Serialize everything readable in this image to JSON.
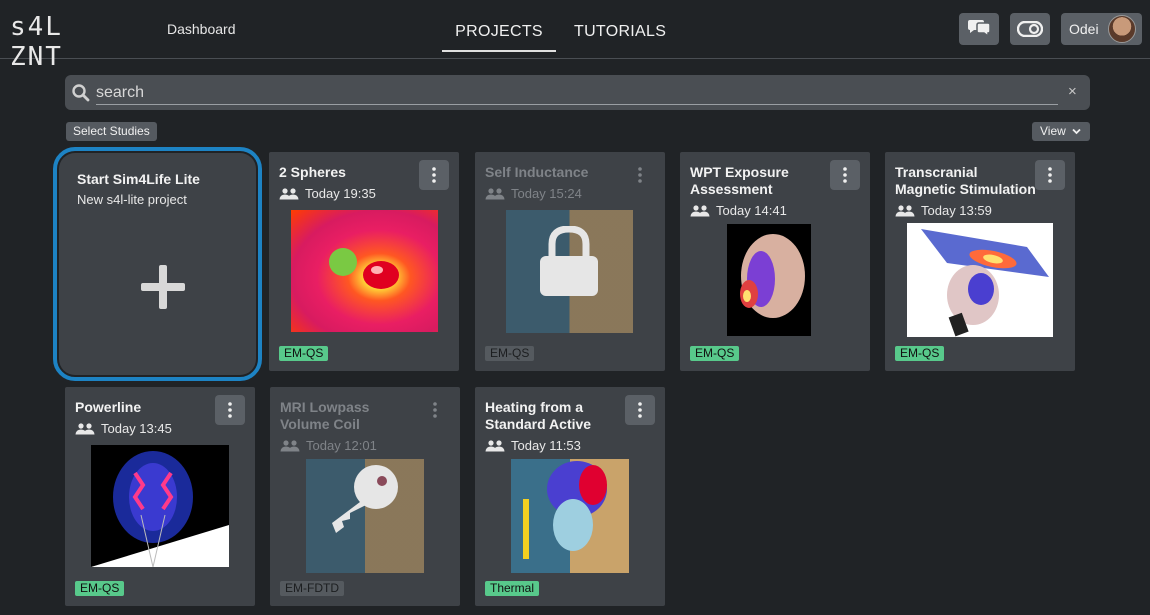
{
  "header": {
    "logo_text": "s4L ZNT",
    "dashboard": "Dashboard",
    "tabs": [
      {
        "label": "PROJECTS",
        "active": true
      },
      {
        "label": "TUTORIALS",
        "active": false
      }
    ],
    "user_name": "Odei",
    "icons": [
      "chat-icon",
      "toggle-icon",
      "avatar"
    ]
  },
  "search": {
    "placeholder": "search",
    "clear_icon": "×"
  },
  "toolbar": {
    "select_studies": "Select Studies",
    "view": "View"
  },
  "new_study": {
    "title": "Start Sim4Life Lite",
    "subtitle": "New s4l-lite project"
  },
  "studies": [
    {
      "title": "2 Spheres",
      "time": "Today 19:35",
      "tag": "EM-QS",
      "locked": false
    },
    {
      "title": "Self Inductance",
      "time": "Today 15:24",
      "tag": "EM-QS",
      "locked": true
    },
    {
      "title": "WPT Exposure Assessment",
      "time": "Today 14:41",
      "tag": "EM-QS",
      "locked": false
    },
    {
      "title": "Transcranial Magnetic Stimulation",
      "time": "Today 13:59",
      "tag": "EM-QS",
      "locked": false
    },
    {
      "title": "Powerline",
      "time": "Today 13:45",
      "tag": "EM-QS",
      "locked": false
    },
    {
      "title": "MRI Lowpass Volume Coil",
      "time": "Today 12:01",
      "tag": "EM-FDTD",
      "locked": true
    },
    {
      "title": "Heating from a Standard Active",
      "time": "Today 11:53",
      "tag": "Thermal",
      "locked": false
    }
  ],
  "colors": {
    "background": "#202326",
    "card": "#3e4247",
    "accent_border": "#1d83c4",
    "tag_green": "#58c98b",
    "tag_disabled": "#555a5f"
  }
}
